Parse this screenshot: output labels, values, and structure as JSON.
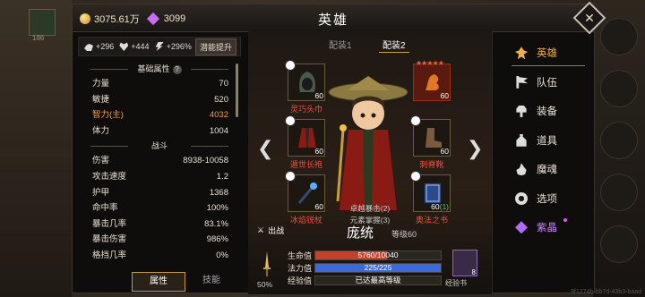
{
  "currency": {
    "gold": "3075.61万",
    "gems": "3099"
  },
  "title": "英雄",
  "left_thumb_label": "186",
  "bonuses": [
    {
      "icon": "arm-icon",
      "value": "+296"
    },
    {
      "icon": "heart-icon",
      "value": "+444"
    },
    {
      "icon": "bolt-icon",
      "value": "+296%"
    }
  ],
  "potential_button": "潜能提升",
  "basic_header": "基础属性",
  "basic_stats": [
    {
      "label": "力量",
      "value": "70"
    },
    {
      "label": "敏捷",
      "value": "520"
    },
    {
      "label": "智力(主)",
      "value": "4032"
    },
    {
      "label": "体力",
      "value": "1004"
    }
  ],
  "combat_header": "战斗",
  "combat_stats": [
    {
      "label": "伤害",
      "value": "8938-10058"
    },
    {
      "label": "攻击速度",
      "value": "1.2"
    },
    {
      "label": "护甲",
      "value": "1368"
    },
    {
      "label": "命中率",
      "value": "100%"
    },
    {
      "label": "暴击几率",
      "value": "83.1%"
    },
    {
      "label": "暴击伤害",
      "value": "986%"
    },
    {
      "label": "格挡几率",
      "value": "0%"
    }
  ],
  "left_tabs": {
    "attributes": "属性",
    "skills": "技能"
  },
  "loadouts": [
    "配装1",
    "配装2"
  ],
  "equipment": {
    "head": {
      "name": "灵巧头巾",
      "level": "60"
    },
    "body": {
      "name": "遁世长袍",
      "level": "60"
    },
    "weapon": {
      "name": "冰焰锐杖",
      "level": "60"
    },
    "trinket": {
      "name": "",
      "level": "60"
    },
    "boots": {
      "name": "刺脊靴",
      "level": "60"
    },
    "book": {
      "name": "奥法之书",
      "level": "60",
      "bonus": "(1)"
    }
  },
  "set_bonuses": [
    "卓越暴击(2)",
    "元素掌握(3)"
  ],
  "deploy_label": "出战",
  "hero": {
    "name": "庞统",
    "level_label": "等级60"
  },
  "bars": {
    "hp": {
      "label": "生命值",
      "current": 5760,
      "max": 10040,
      "text": "5760/10040",
      "color": "#c8402a"
    },
    "mp": {
      "label": "法力值",
      "current": 225,
      "max": 225,
      "text": "225/225",
      "color": "#3a6ae0"
    },
    "xp": {
      "label": "经验值",
      "text": "已达最高等级"
    }
  },
  "sword_percent": "50%",
  "exp_book": {
    "count": "8",
    "label": "经验书"
  },
  "nav": [
    {
      "label": "英雄",
      "icon": "hero-icon",
      "active": true
    },
    {
      "label": "队伍",
      "icon": "flag-icon"
    },
    {
      "label": "装备",
      "icon": "helmet-icon"
    },
    {
      "label": "道具",
      "icon": "bag-icon"
    },
    {
      "label": "魔魂",
      "icon": "flame-icon"
    },
    {
      "label": "选项",
      "icon": "gear-icon"
    },
    {
      "label": "紫晶",
      "icon": "amethyst-icon"
    }
  ],
  "watermark": "9f1274b-bb7d-43b3-baad"
}
